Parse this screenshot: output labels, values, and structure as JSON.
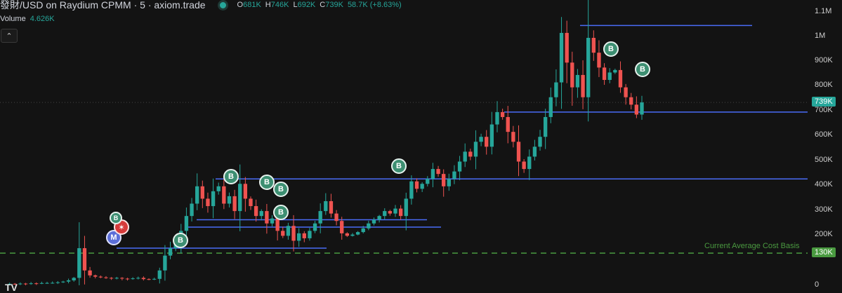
{
  "header": {
    "title": "發財/USD on Raydium CPMM · 5 · axiom.trade",
    "ohlc": [
      {
        "k": "O",
        "v": "681K"
      },
      {
        "k": "H",
        "v": "746K"
      },
      {
        "k": "L",
        "v": "692K"
      },
      {
        "k": "C",
        "v": "739K"
      }
    ],
    "change": "58.7K (+8.63%)"
  },
  "volume": {
    "label": "Volume",
    "value": "4.626K"
  },
  "collapse_icon": "chevron-up-icon",
  "colors": {
    "background": "#131313",
    "up": "#26a69a",
    "down": "#ef5350",
    "level_line": "#4a6cf7",
    "avg_cost": "#4a9a40"
  },
  "markers": {
    "buy": "B",
    "migrate": "M"
  },
  "avg_cost_label": "Current Average Cost Basis",
  "chart_data": {
    "type": "candlestick",
    "yaxis": {
      "ticks": [
        "1.1M",
        "1M",
        "900K",
        "800K",
        "700K",
        "600K",
        "500K",
        "400K",
        "300K",
        "200K",
        "0"
      ],
      "tick_values": [
        1100000,
        1000000,
        900000,
        800000,
        700000,
        600000,
        500000,
        400000,
        300000,
        200000,
        0
      ]
    },
    "current_price": {
      "label": "739K",
      "value": 739000
    },
    "avg_cost": {
      "label": "130K",
      "value": 130000
    },
    "horizontal_levels": [
      1050000,
      700000,
      430000,
      265000,
      235000,
      150000
    ],
    "close_path": [
      5000,
      6000,
      5500,
      7000,
      6500,
      8000,
      7500,
      9000,
      9500,
      10000,
      12000,
      15000,
      20000,
      30000,
      150000,
      60000,
      40000,
      35000,
      32000,
      30000,
      28000,
      30000,
      27000,
      26000,
      28000,
      30000,
      25000,
      24000,
      26000,
      60000,
      120000,
      150000,
      170000,
      220000,
      280000,
      330000,
      400000,
      350000,
      320000,
      380000,
      400000,
      330000,
      360000,
      300000,
      410000,
      350000,
      320000,
      280000,
      300000,
      250000,
      270000,
      220000,
      200000,
      240000,
      180000,
      210000,
      190000,
      220000,
      250000,
      300000,
      340000,
      290000,
      260000,
      210000,
      200000,
      205000,
      215000,
      230000,
      250000,
      265000,
      280000,
      300000,
      290000,
      310000,
      280000,
      350000,
      420000,
      390000,
      410000,
      430000,
      470000,
      450000,
      400000,
      430000,
      460000,
      500000,
      540000,
      520000,
      580000,
      600000,
      560000,
      650000,
      700000,
      680000,
      620000,
      580000,
      500000,
      470000,
      520000,
      560000,
      600000,
      680000,
      760000,
      820000,
      1020000,
      900000,
      800000,
      850000,
      760000,
      1000000,
      940000,
      880000,
      830000,
      860000,
      870000,
      800000,
      760000,
      730000,
      690000,
      739000
    ]
  }
}
